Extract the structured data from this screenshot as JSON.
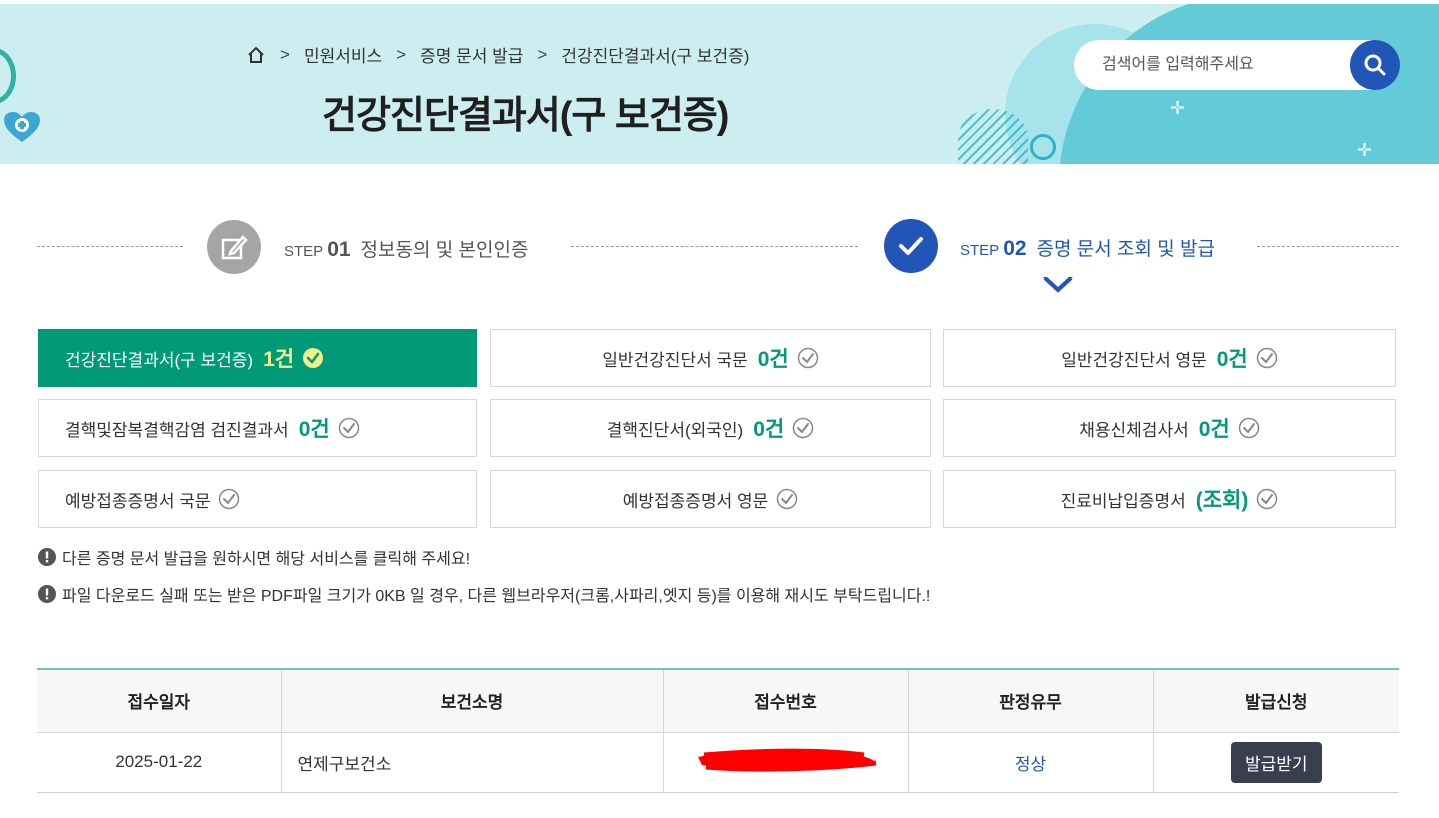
{
  "header": {
    "breadcrumb": [
      "민원서비스",
      "증명 문서 발급",
      "건강진단결과서(구 보건증)"
    ],
    "title": "건강진단결과서(구 보건증)",
    "search_placeholder": "검색어를 입력해주세요"
  },
  "steps": [
    {
      "word": "STEP",
      "num": "01",
      "label": "정보동의 및 본인인증",
      "icon": "pencil-icon",
      "state": "done"
    },
    {
      "word": "STEP",
      "num": "02",
      "label": "증명 문서 조회 및 발급",
      "icon": "check-icon",
      "state": "current"
    }
  ],
  "services": [
    {
      "label": "건강진단결과서(구 보건증)",
      "count": "1건",
      "active": true
    },
    {
      "label": "일반건강진단서 국문",
      "count": "0건"
    },
    {
      "label": "일반건강진단서 영문",
      "count": "0건"
    },
    {
      "label": "결핵및잠복결핵감염 검진결과서",
      "count": "0건"
    },
    {
      "label": "결핵진단서(외국인)",
      "count": "0건"
    },
    {
      "label": "채용신체검사서",
      "count": "0건"
    },
    {
      "label": "예방접종증명서 국문",
      "count": ""
    },
    {
      "label": "예방접종증명서 영문",
      "count": ""
    },
    {
      "label": "진료비납입증명서",
      "count": "(조회)"
    }
  ],
  "notices": [
    "다른 증명 문서 발급을 원하시면 해당 서비스를 클릭해 주세요!",
    "파일 다운로드 실패 또는 받은 PDF파일 크기가 0KB 일 경우, 다른 웹브라우저(크롬,사파리,엣지 등)를 이용해 재시도 부탁드립니다.!"
  ],
  "table": {
    "headers": [
      "접수일자",
      "보건소명",
      "접수번호",
      "판정유무",
      "발급신청"
    ],
    "rows": [
      {
        "date": "2025-01-22",
        "center": "연제구보건소",
        "receipt_no_redacted": true,
        "result": "정상",
        "action": "발급받기"
      }
    ]
  },
  "colors": {
    "accent_green": "#009a78",
    "accent_blue": "#2255b8",
    "banner_bg": "#cdeef1",
    "redaction": "#ff0000"
  }
}
